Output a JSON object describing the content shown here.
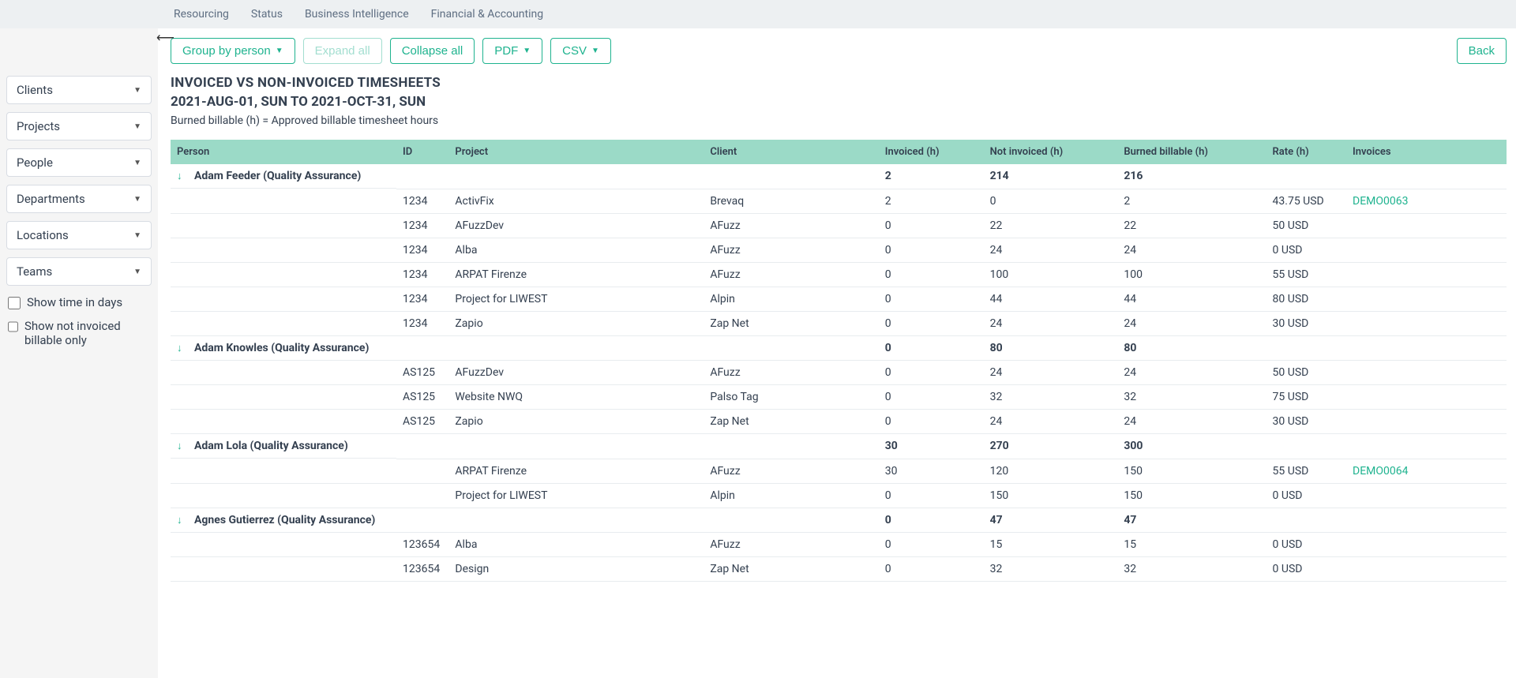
{
  "nav": {
    "items": [
      "Resourcing",
      "Status",
      "Business Intelligence",
      "Financial & Accounting"
    ]
  },
  "sidebar": {
    "filters": [
      "Clients",
      "Projects",
      "People",
      "Departments",
      "Locations",
      "Teams"
    ],
    "cb_time_in_days": "Show time in days",
    "cb_not_invoiced": "Show not invoiced billable only"
  },
  "toolbar": {
    "group_by": "Group by person",
    "expand_all": "Expand all",
    "collapse_all": "Collapse all",
    "pdf": "PDF",
    "csv": "CSV",
    "back": "Back"
  },
  "headings": {
    "title": "INVOICED VS NON-INVOICED TIMESHEETS",
    "dates": "2021-AUG-01, SUN TO 2021-OCT-31, SUN",
    "subtitle": "Burned billable (h) = Approved billable timesheet hours"
  },
  "table": {
    "columns": [
      "Person",
      "ID",
      "Project",
      "Client",
      "Invoiced (h)",
      "Not invoiced (h)",
      "Burned billable (h)",
      "Rate (h)",
      "Invoices"
    ],
    "groups": [
      {
        "person": "Adam Feeder (Quality Assurance)",
        "totals": {
          "invoiced": "2",
          "not_invoiced": "214",
          "burned": "216"
        },
        "rows": [
          {
            "id": "1234",
            "project": "ActivFix",
            "client": "Brevaq",
            "invoiced": "2",
            "not_invoiced": "0",
            "burned": "2",
            "rate": "43.75 USD",
            "invoice": "DEMO0063"
          },
          {
            "id": "1234",
            "project": "AFuzzDev",
            "client": "AFuzz",
            "invoiced": "0",
            "not_invoiced": "22",
            "burned": "22",
            "rate": "50 USD",
            "invoice": ""
          },
          {
            "id": "1234",
            "project": "Alba",
            "client": "AFuzz",
            "invoiced": "0",
            "not_invoiced": "24",
            "burned": "24",
            "rate": "0 USD",
            "invoice": ""
          },
          {
            "id": "1234",
            "project": "ARPAT Firenze",
            "client": "AFuzz",
            "invoiced": "0",
            "not_invoiced": "100",
            "burned": "100",
            "rate": "55 USD",
            "invoice": ""
          },
          {
            "id": "1234",
            "project": "Project for LIWEST",
            "client": "Alpin",
            "invoiced": "0",
            "not_invoiced": "44",
            "burned": "44",
            "rate": "80 USD",
            "invoice": ""
          },
          {
            "id": "1234",
            "project": "Zapio",
            "client": "Zap Net",
            "invoiced": "0",
            "not_invoiced": "24",
            "burned": "24",
            "rate": "30 USD",
            "invoice": ""
          }
        ]
      },
      {
        "person": "Adam Knowles (Quality Assurance)",
        "totals": {
          "invoiced": "0",
          "not_invoiced": "80",
          "burned": "80"
        },
        "rows": [
          {
            "id": "AS125",
            "project": "AFuzzDev",
            "client": "AFuzz",
            "invoiced": "0",
            "not_invoiced": "24",
            "burned": "24",
            "rate": "50 USD",
            "invoice": ""
          },
          {
            "id": "AS125",
            "project": "Website NWQ",
            "client": "Palso Tag",
            "invoiced": "0",
            "not_invoiced": "32",
            "burned": "32",
            "rate": "75 USD",
            "invoice": ""
          },
          {
            "id": "AS125",
            "project": "Zapio",
            "client": "Zap Net",
            "invoiced": "0",
            "not_invoiced": "24",
            "burned": "24",
            "rate": "30 USD",
            "invoice": ""
          }
        ]
      },
      {
        "person": "Adam Lola (Quality Assurance)",
        "totals": {
          "invoiced": "30",
          "not_invoiced": "270",
          "burned": "300"
        },
        "rows": [
          {
            "id": "",
            "project": "ARPAT Firenze",
            "client": "AFuzz",
            "invoiced": "30",
            "not_invoiced": "120",
            "burned": "150",
            "rate": "55 USD",
            "invoice": "DEMO0064"
          },
          {
            "id": "",
            "project": "Project for LIWEST",
            "client": "Alpin",
            "invoiced": "0",
            "not_invoiced": "150",
            "burned": "150",
            "rate": "0 USD",
            "invoice": ""
          }
        ]
      },
      {
        "person": "Agnes Gutierrez (Quality Assurance)",
        "totals": {
          "invoiced": "0",
          "not_invoiced": "47",
          "burned": "47"
        },
        "rows": [
          {
            "id": "123654",
            "project": "Alba",
            "client": "AFuzz",
            "invoiced": "0",
            "not_invoiced": "15",
            "burned": "15",
            "rate": "0 USD",
            "invoice": ""
          },
          {
            "id": "123654",
            "project": "Design",
            "client": "Zap Net",
            "invoiced": "0",
            "not_invoiced": "32",
            "burned": "32",
            "rate": "0 USD",
            "invoice": ""
          }
        ]
      }
    ]
  }
}
